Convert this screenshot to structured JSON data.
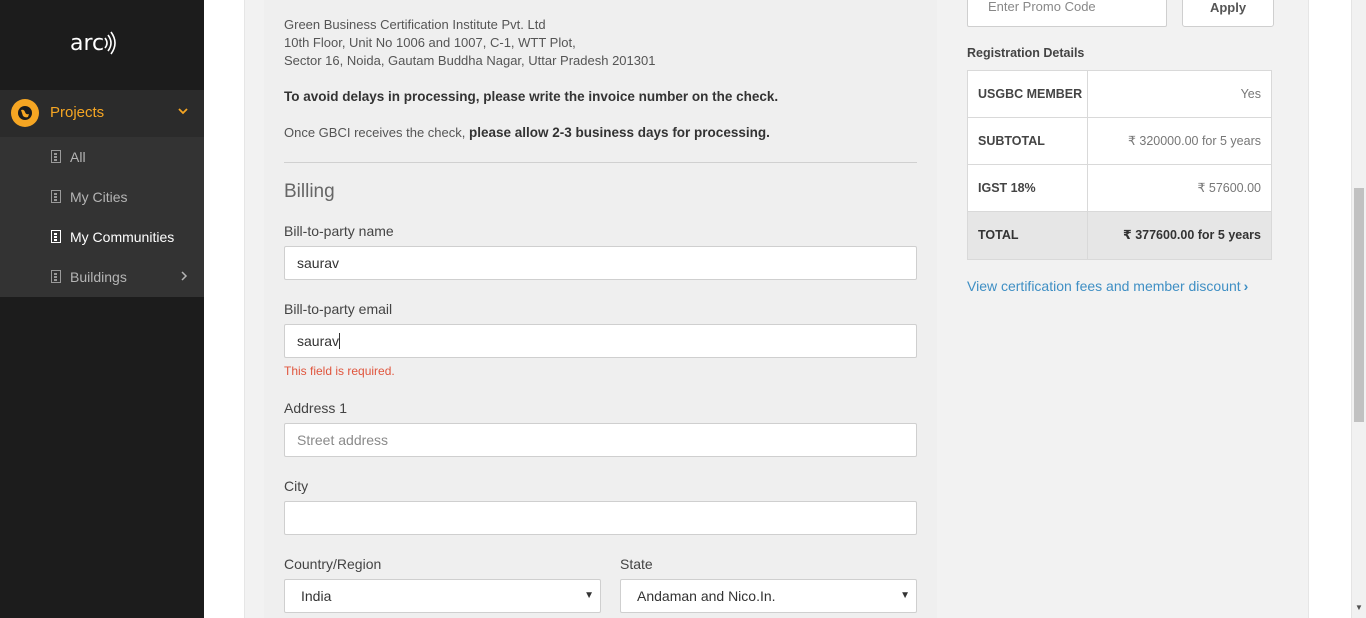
{
  "sidebar": {
    "logo": "arc",
    "projects_label": "Projects",
    "items": [
      {
        "label": "All"
      },
      {
        "label": "My Cities"
      },
      {
        "label": "My Communities"
      },
      {
        "label": "Buildings"
      }
    ]
  },
  "payment_info": {
    "address_line1": "Green Business Certification Institute Pvt. Ltd",
    "address_line2": "10th Floor, Unit No 1006 and 1007, C-1, WTT Plot,",
    "address_line3": "Sector 16, Noida, Gautam Buddha Nagar, Uttar Pradesh 201301",
    "invoice_note": "To avoid delays in processing, please write the invoice number on the check.",
    "receipt_note_prefix": "Once GBCI receives the check, ",
    "receipt_note_bold": "please allow 2-3 business days for processing."
  },
  "billing": {
    "title": "Billing",
    "name_label": "Bill-to-party name",
    "name_value": "saurav",
    "email_label": "Bill-to-party email",
    "email_value": "saurav",
    "email_error": "This field is required.",
    "address_label": "Address 1",
    "address_placeholder": "Street address",
    "city_label": "City",
    "city_value": "",
    "country_label": "Country/Region",
    "country_value": "India",
    "state_label": "State",
    "state_value": "Andaman and Nico.In."
  },
  "order": {
    "promo_placeholder": "Enter Promo Code",
    "apply_label": "Apply",
    "reg_title": "Registration Details",
    "rows": [
      {
        "key": "USGBC MEMBER",
        "value": "Yes"
      },
      {
        "key": "SUBTOTAL",
        "value": "₹ 320000.00 for 5 years"
      },
      {
        "key": "IGST 18%",
        "value": "₹ 57600.00"
      },
      {
        "key": "TOTAL",
        "value": "₹ 377600.00 for 5 years"
      }
    ],
    "fees_link": "View certification fees and member discount"
  },
  "colors": {
    "accent": "#f6a623",
    "link": "#3f8fc4",
    "error": "#e0553d",
    "sidebar_bg": "#1c1c1c"
  }
}
